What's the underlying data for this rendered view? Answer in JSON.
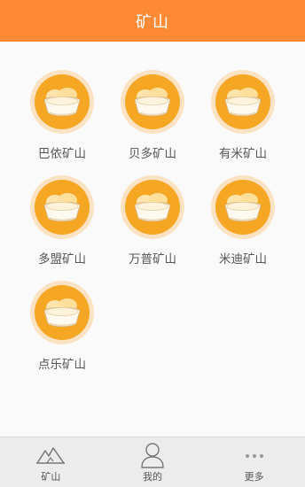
{
  "header": {
    "title": "矿山"
  },
  "mines": [
    {
      "label": "巴依矿山",
      "icon": "gold-ingot-icon"
    },
    {
      "label": "贝多矿山",
      "icon": "gold-ingot-icon"
    },
    {
      "label": "有米矿山",
      "icon": "gold-ingot-icon"
    },
    {
      "label": "多盟矿山",
      "icon": "gold-ingot-icon"
    },
    {
      "label": "万普矿山",
      "icon": "gold-ingot-icon"
    },
    {
      "label": "米迪矿山",
      "icon": "gold-ingot-icon"
    },
    {
      "label": "点乐矿山",
      "icon": "gold-ingot-icon"
    }
  ],
  "tabbar": {
    "tabs": [
      {
        "label": "矿山",
        "icon": "mountain-icon"
      },
      {
        "label": "我的",
        "icon": "user-icon"
      },
      {
        "label": "更多",
        "icon": "more-dots-icon"
      }
    ]
  },
  "colors": {
    "header_bg": "#ff8a35",
    "icon_ring": "#fbe2c3",
    "icon_fill": "#f5a623",
    "ingot": "#fffaf0"
  }
}
